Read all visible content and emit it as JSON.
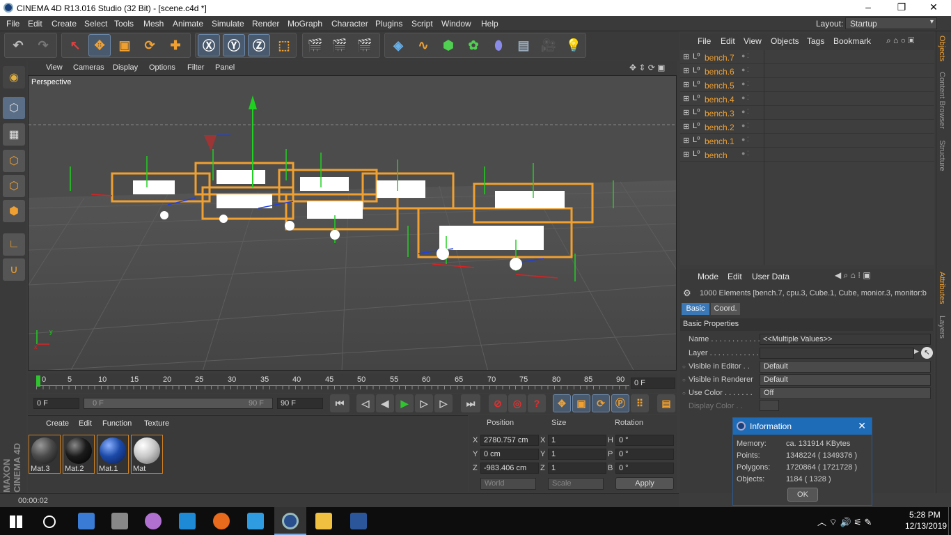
{
  "window": {
    "title": "CINEMA 4D R13.016 Studio (32 Bit) - [scene.c4d *]",
    "minimize": "–",
    "maximize": "❐",
    "close": "✕"
  },
  "menu": [
    "File",
    "Edit",
    "Create",
    "Select",
    "Tools",
    "Mesh",
    "Animate",
    "Simulate",
    "Render",
    "MoGraph",
    "Character",
    "Plugins",
    "Script",
    "Window",
    "Help"
  ],
  "layout": {
    "label": "Layout:",
    "value": "Startup"
  },
  "viewport": {
    "menu": [
      "View",
      "Cameras",
      "Display",
      "Options",
      "Filter",
      "Panel"
    ],
    "label": "Perspective"
  },
  "timeline": {
    "ticks": [
      "0",
      "5",
      "10",
      "15",
      "20",
      "25",
      "30",
      "35",
      "40",
      "45",
      "50",
      "55",
      "60",
      "65",
      "70",
      "75",
      "80",
      "85",
      "90"
    ],
    "current_frame": "0 F"
  },
  "transport": {
    "start": "0 F",
    "range_start": "0 F",
    "range_end": "90 F",
    "end": "90 F"
  },
  "material_manager": {
    "menu": [
      "Create",
      "Edit",
      "Function",
      "Texture"
    ],
    "materials": [
      {
        "name": "Mat.3",
        "color": "#4a4a4a"
      },
      {
        "name": "Mat.2",
        "color": "#1a1a1a"
      },
      {
        "name": "Mat.1",
        "color": "#1c4aa8"
      },
      {
        "name": "Mat",
        "color": "#c8c8c8"
      }
    ]
  },
  "coordinates": {
    "headers": [
      "Position",
      "Size",
      "Rotation"
    ],
    "rows": [
      {
        "axis": "X",
        "pos": "2780.757 cm",
        "saxis": "X",
        "size": "1",
        "raxis": "H",
        "rot": "0 °"
      },
      {
        "axis": "Y",
        "pos": "0 cm",
        "saxis": "Y",
        "size": "1",
        "raxis": "P",
        "rot": "0 °"
      },
      {
        "axis": "Z",
        "pos": "-983.406 cm",
        "saxis": "Z",
        "size": "1",
        "raxis": "B",
        "rot": "0 °"
      }
    ],
    "mode1": "World",
    "mode2": "Scale",
    "apply": "Apply"
  },
  "status": {
    "time": "00:00:02"
  },
  "objects": {
    "menu": [
      "File",
      "Edit",
      "View",
      "Objects",
      "Tags",
      "Bookmark"
    ],
    "items": [
      "bench.7",
      "bench.6",
      "bench.5",
      "bench.4",
      "bench.3",
      "bench.2",
      "bench.1",
      "bench"
    ]
  },
  "attributes": {
    "menu": [
      "Mode",
      "Edit",
      "User Data"
    ],
    "summary": "1000 Elements [bench.7, cpu.3, Cube.1, Cube, monior.3, monitor:b",
    "tabs": [
      "Basic",
      "Coord."
    ],
    "section": "Basic Properties",
    "fields": {
      "name_label": "Name . . . . . . . . . . . .",
      "name_value": "<<Multiple Values>>",
      "layer_label": "Layer . . . . . . . . . . . .",
      "vis_editor_label": "Visible in Editor . .",
      "vis_editor_value": "Default",
      "vis_render_label": "Visible in Renderer",
      "vis_render_value": "Default",
      "use_color_label": "Use Color . . . . . . .",
      "use_color_value": "Off",
      "display_color_label": "Display Color . ."
    }
  },
  "right_tabs": [
    "Objects",
    "Content Browser",
    "Structure",
    "Attributes",
    "Layers"
  ],
  "info_dialog": {
    "title": "Information",
    "rows": [
      {
        "label": "Memory:",
        "value": "ca. 131914 KBytes"
      },
      {
        "label": "Points:",
        "value": "1348224 ( 1349376 )"
      },
      {
        "label": "Polygons:",
        "value": "1720864 ( 1721728 )"
      },
      {
        "label": "Objects:",
        "value": "1184 ( 1328 )"
      }
    ],
    "ok": "OK"
  },
  "brand": "MAXON CINEMA 4D",
  "taskbar": {
    "time": "5:28 PM",
    "date": "12/13/2019"
  }
}
